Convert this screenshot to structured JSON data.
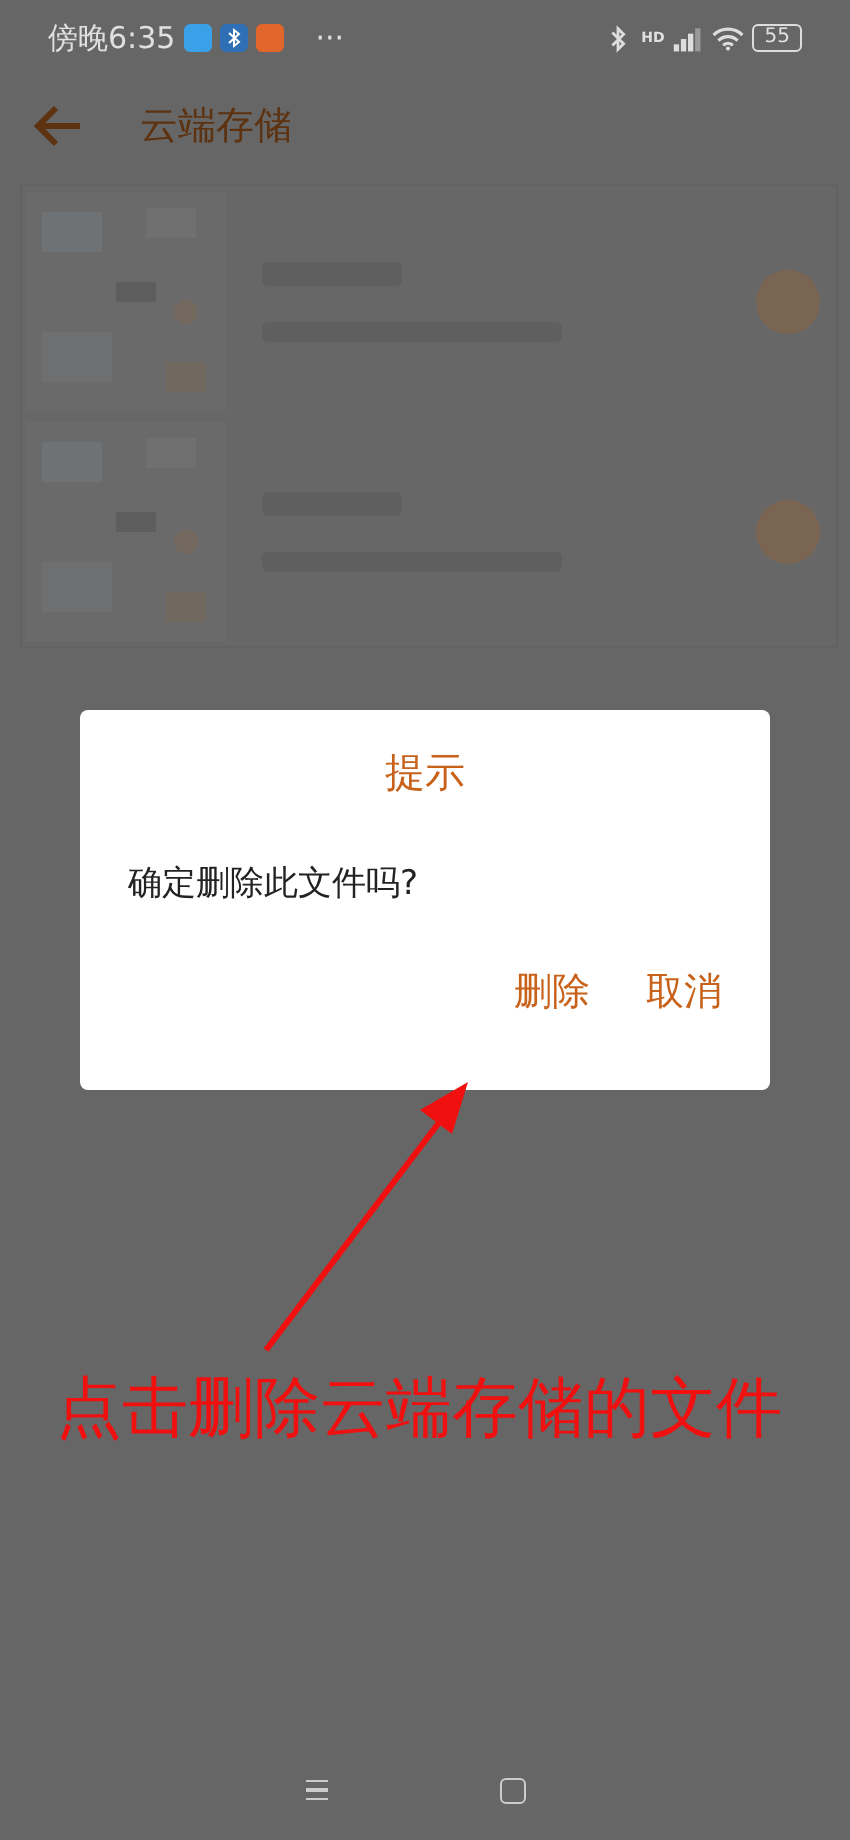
{
  "status_bar": {
    "time": "傍晚6:35",
    "more": "···",
    "network": "HD",
    "battery": "55"
  },
  "header": {
    "title": "云端存储"
  },
  "files": [
    {
      "kind": "file"
    },
    {
      "kind": "file"
    }
  ],
  "dialog": {
    "title": "提示",
    "message": "确定删除此文件吗?",
    "buttons": [
      "删除",
      "取消"
    ]
  },
  "annotation": {
    "caption": "点击删除云端存储的文件"
  }
}
